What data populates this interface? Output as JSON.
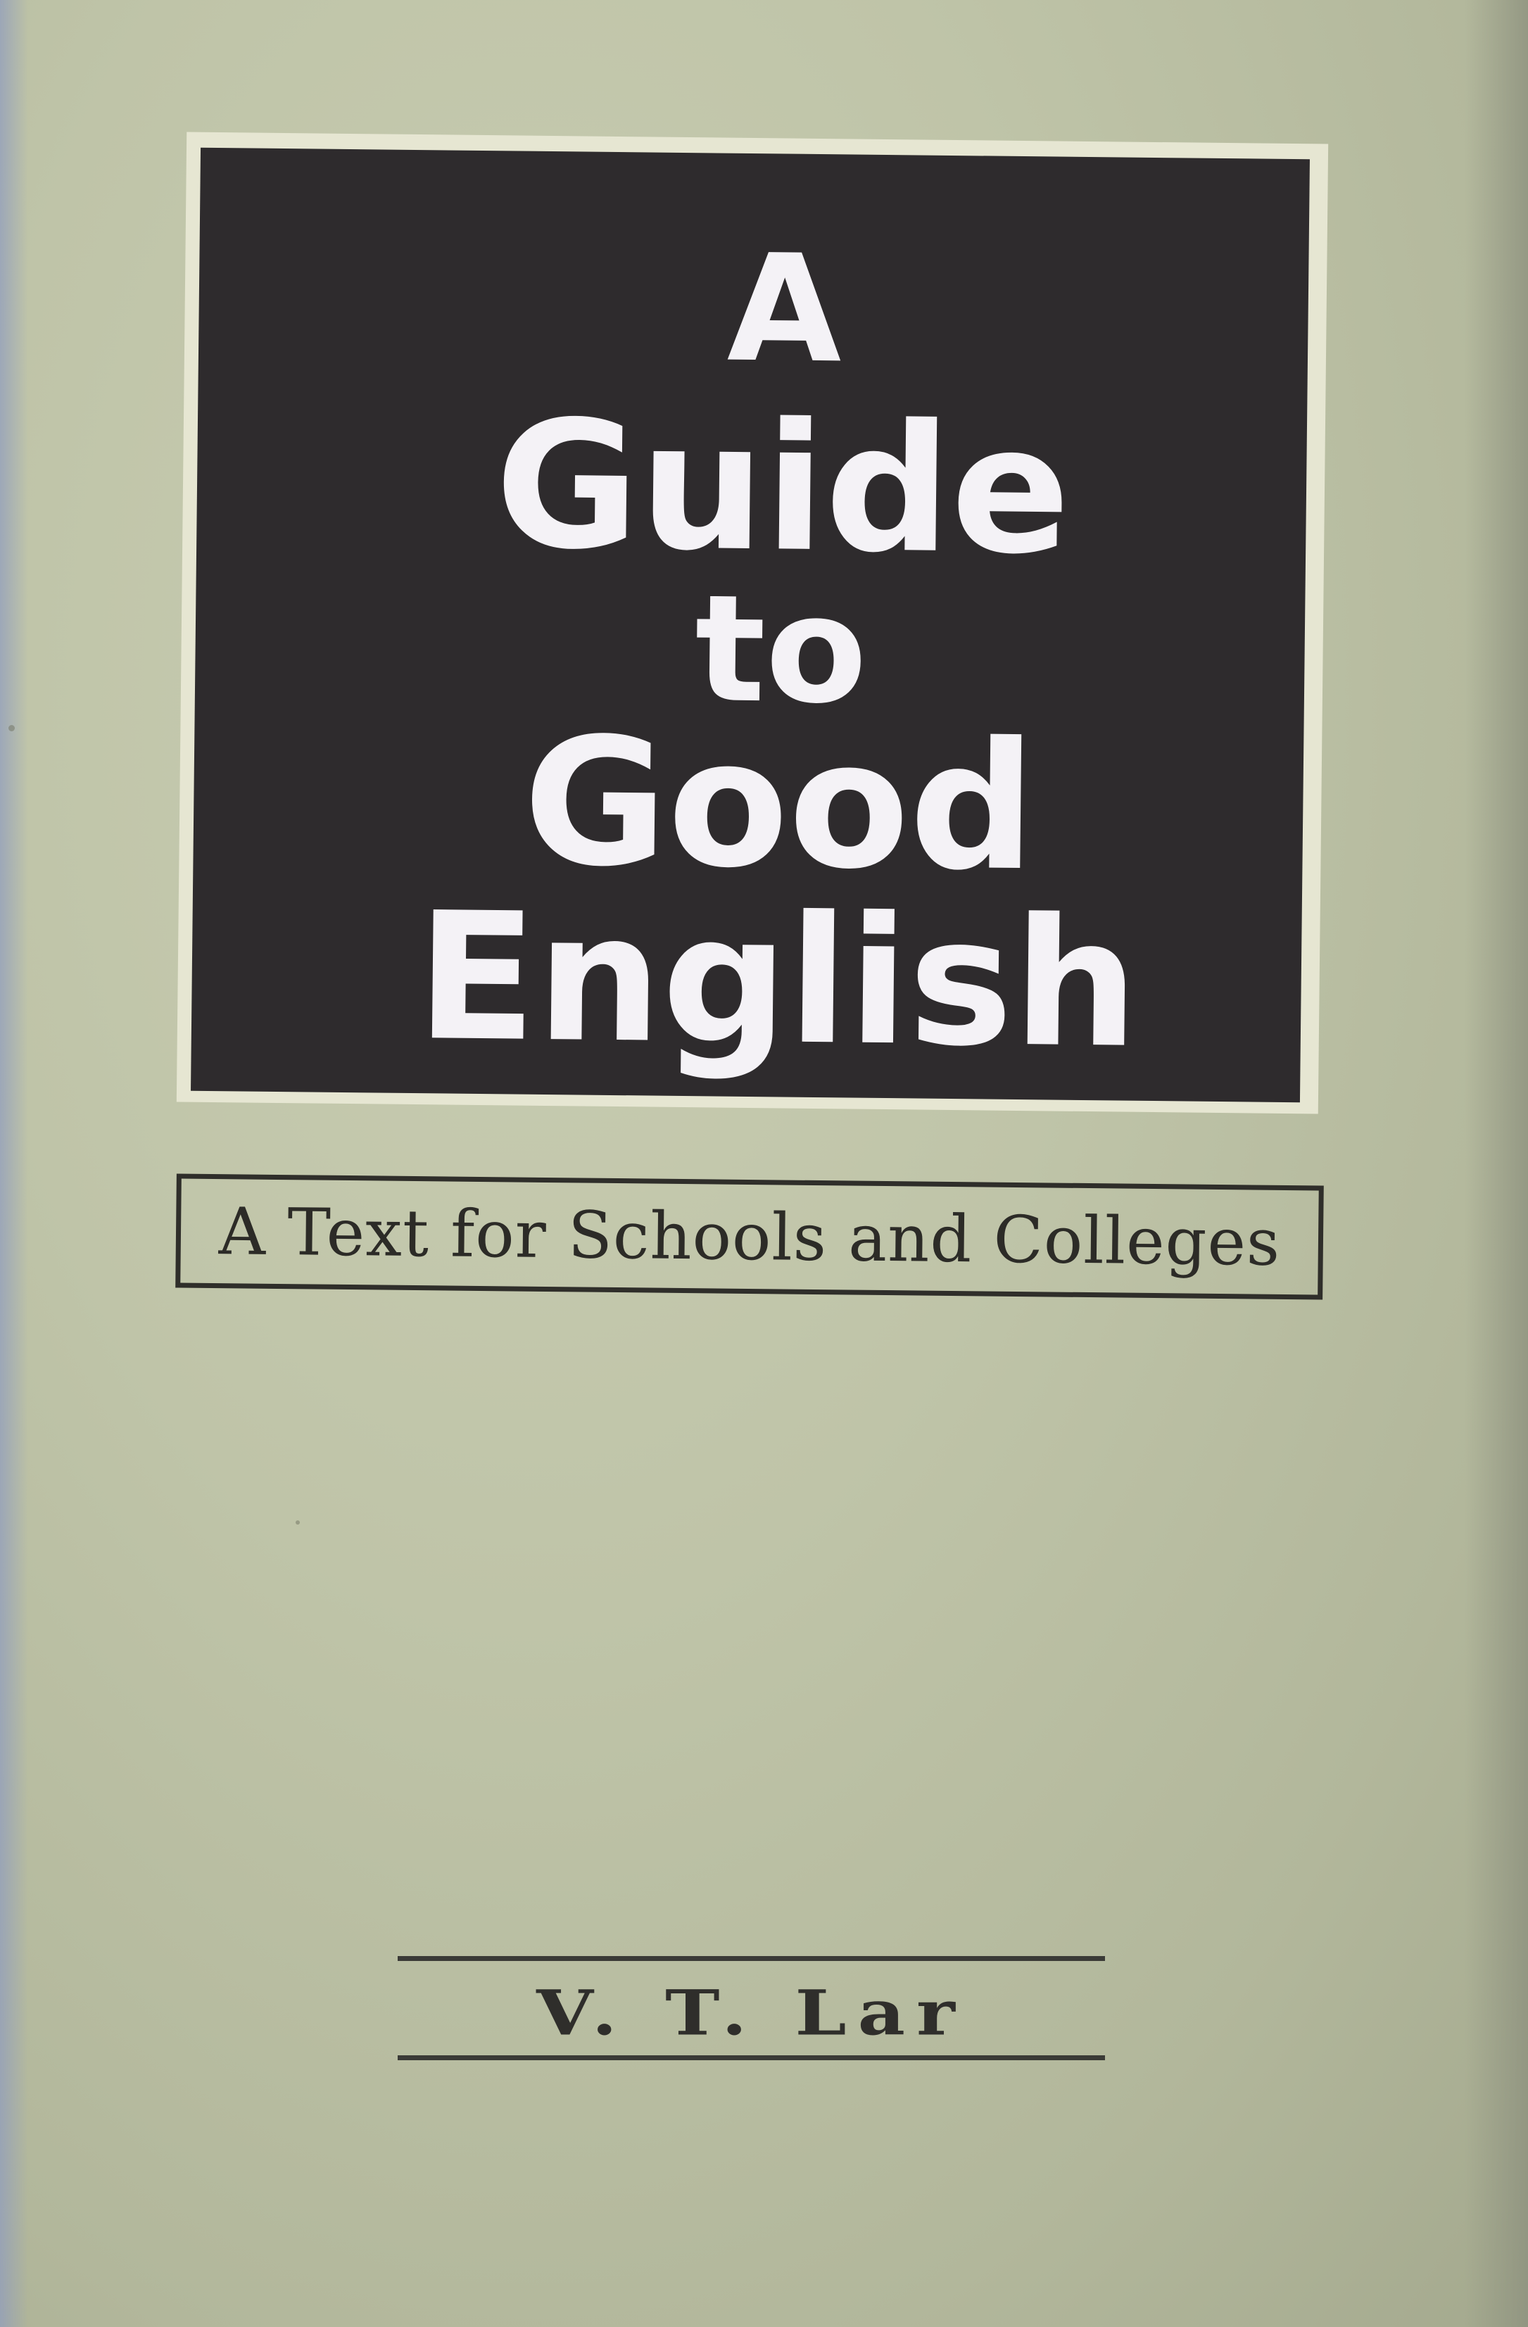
{
  "cover": {
    "title_lines": [
      "A",
      "Guide",
      "to",
      "Good",
      "English"
    ],
    "subtitle": "A Text for Schools and Colleges",
    "author": "V. T. Lar"
  },
  "colors": {
    "cover_background": "#bfc4a8",
    "title_panel": "#2e2b2d",
    "title_text": "#f4f2f6",
    "print_ink": "#2f2e2a"
  }
}
